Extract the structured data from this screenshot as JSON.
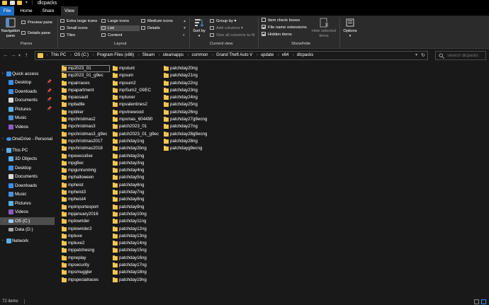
{
  "window": {
    "title": "dlcpacks",
    "accent": "#1a6fc4",
    "folder_color": "#f3c44e"
  },
  "tabs": [
    {
      "label": "File"
    },
    {
      "label": "Home"
    },
    {
      "label": "Share"
    },
    {
      "label": "View"
    }
  ],
  "ribbon": {
    "panes": {
      "navigation_pane": "Navigation pane",
      "preview_pane": "Preview pane",
      "details_pane": "Details pane",
      "group_label": "Panes"
    },
    "layout": {
      "extra_large_icons": "Extra large icons",
      "large_icons": "Large icons",
      "medium_icons": "Medium icons",
      "small_icons": "Small icons",
      "list": "List",
      "details": "Details",
      "tiles": "Tiles",
      "content": "Content",
      "selected": "List",
      "group_label": "Layout"
    },
    "current_view": {
      "sort_by": "Sort by",
      "group_by": "Group by",
      "add_columns": "Add columns",
      "size_all_columns": "Size all columns to fit",
      "group_label": "Current view"
    },
    "show_hide": {
      "item_check_boxes": "Item check boxes",
      "item_check_boxes_checked": false,
      "file_name_extensions": "File name extensions",
      "file_name_extensions_checked": true,
      "hidden_items": "Hidden items",
      "hidden_items_checked": true,
      "hide_selected_items": "Hide selected items",
      "group_label": "Show/hide"
    },
    "options": "Options"
  },
  "address": {
    "crumbs": [
      "This PC",
      "OS (C:)",
      "Program Files (x86)",
      "Steam",
      "steamapps",
      "common",
      "Grand Theft Auto V",
      "update",
      "x64",
      "dlcpacks"
    ],
    "search_placeholder": "Search dlcpacks"
  },
  "nav": {
    "quick_access": "Quick access",
    "quick_items": [
      "Desktop",
      "Downloads",
      "Documents",
      "Pictures",
      "Music",
      "Videos"
    ],
    "onedrive": "OneDrive - Personal",
    "this_pc": "This PC",
    "pc_items": [
      "3D Objects",
      "Desktop",
      "Documents",
      "Downloads",
      "Music",
      "Pictures",
      "Videos",
      "OS (C:)",
      "Data (D:)"
    ],
    "selected": "OS (C:)",
    "network": "Network"
  },
  "files": {
    "columns": [
      [
        "mp2023_01",
        "mp2023_01_g9ec",
        "mpairraces",
        "mpapartment",
        "mpassault",
        "mpbattle",
        "mpbiker",
        "mpchristmas2",
        "mpchristmas3",
        "mpchristmas3_g9ec",
        "mpchristmas2017",
        "mpchristmas2018",
        "mpexecutive",
        "mpg9ec",
        "mpgunrunning",
        "mphalloween",
        "mpheist",
        "mpheist3",
        "mpheist4",
        "mpimportexport",
        "mpjanuary2016",
        "mplowrider",
        "mplowrider2",
        "mpluxe",
        "mpluxe2",
        "mppatchesng",
        "mpreplay",
        "mpsecurity",
        "mpsmuggler",
        "mpspecialraces"
      ],
      [
        "mpstunt",
        "mpsum",
        "mpsum2",
        "mpSum2_G9EC",
        "mptuner",
        "mpvalentines2",
        "mpvinewood",
        "mpxmas_604490",
        "patch2023_01",
        "patch2023_01_g9ec",
        "patchday1ng",
        "patchday2bng",
        "patchday2ng",
        "patchday3ng",
        "patchday4ng",
        "patchday5ng",
        "patchday6ng",
        "patchday7ng",
        "patchday8ng",
        "patchday9ng",
        "patchday10ng",
        "patchday11ng",
        "patchday12ng",
        "patchday13ng",
        "patchday14ng",
        "patchday15ng",
        "patchday16ng",
        "patchday17ng",
        "patchday18ng",
        "patchday19ng"
      ],
      [
        "patchday20ng",
        "patchday21ng",
        "patchday22ng",
        "patchday23ng",
        "patchday24ng",
        "patchday25ng",
        "patchday26ng",
        "patchday27g9ecng",
        "patchday27ng",
        "patchday28g9ecng",
        "patchday28ng",
        "patchdayg9ecng"
      ]
    ],
    "selected": "mp2023_01"
  },
  "status": {
    "item_count": "72 items"
  }
}
